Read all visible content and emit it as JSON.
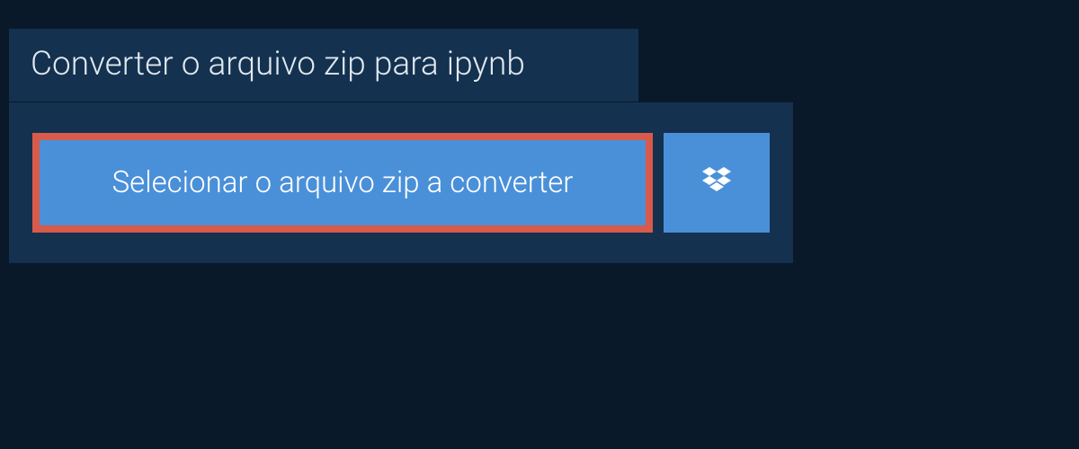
{
  "header": {
    "title": "Converter o arquivo zip para ipynb"
  },
  "actions": {
    "select_file_label": "Selecionar o arquivo zip a converter",
    "dropbox_icon_name": "dropbox-icon"
  },
  "colors": {
    "page_bg": "#0a1929",
    "panel_bg": "#14314f",
    "button_bg": "#4a90d9",
    "highlight_border": "#d85a4a",
    "text_light": "#ffffff"
  }
}
